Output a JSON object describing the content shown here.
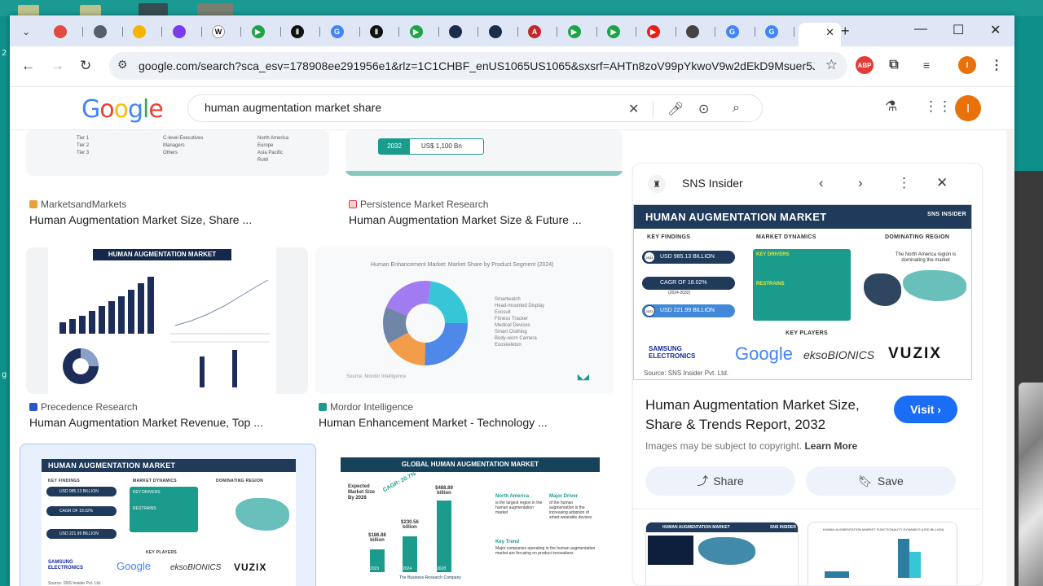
{
  "browser": {
    "url": "google.com/search?sca_esv=178908ee291956e1&rlz=1C1CHBF_enUS1065US1065&sxsrf=AHTn8zoV99pYkwoV9w2dEkD9Msuer5Jl...",
    "tabs": [
      {
        "color": "#e04a3f",
        "glyph": ""
      },
      {
        "color": "#555e6b",
        "glyph": ""
      },
      {
        "color": "#f5b400",
        "glyph": ""
      },
      {
        "color": "#7c3aed",
        "glyph": ""
      },
      {
        "color": "#ffffff",
        "glyph": "W"
      },
      {
        "color": "#1ea446",
        "glyph": "▶"
      },
      {
        "color": "#111111",
        "glyph": "Ⅱ"
      },
      {
        "color": "#4285f4",
        "glyph": "G"
      },
      {
        "color": "#111111",
        "glyph": "Ⅱ"
      },
      {
        "color": "#1ea446",
        "glyph": "▶"
      },
      {
        "color": "#1c2c4c",
        "glyph": ""
      },
      {
        "color": "#1c2c4c",
        "glyph": ""
      },
      {
        "color": "#c62828",
        "glyph": "A"
      },
      {
        "color": "#1ea446",
        "glyph": "▶"
      },
      {
        "color": "#1ea446",
        "glyph": "▶"
      },
      {
        "color": "#e62117",
        "glyph": "▶"
      },
      {
        "color": "#444444",
        "glyph": ""
      },
      {
        "color": "#4285f4",
        "glyph": "G"
      },
      {
        "color": "#4285f4",
        "glyph": "G"
      }
    ]
  },
  "google": {
    "query": "human augmentation market share"
  },
  "results": [
    {
      "source": "MarketsandMarkets",
      "title": "Human Augmentation Market Size, Share ..."
    },
    {
      "source": "Persistence Market Research",
      "title": "Human Augmentation Market Size & Future ..."
    },
    {
      "source": "Precedence Research",
      "title": "Human Augmentation Market Revenue, Top ..."
    },
    {
      "source": "Mordor Intelligence",
      "title": "Human Enhancement Market - Technology ..."
    }
  ],
  "thumbs": {
    "t1_legend": [
      "Tier 1",
      "Tier 2",
      "Tier 3",
      "C-level Executives",
      "Managers",
      "Others",
      "North America",
      "Europe",
      "Asia Pacific",
      "RoW"
    ],
    "t2_year": "2032",
    "t2_value": "US$ 1,100 Bn",
    "t3_title": "HUMAN AUGMENTATION MARKET",
    "t4_title": "Human Enhancement Market: Market Share by Product Segment (2024)",
    "t4_legend": [
      "Smartwatch",
      "Head-mounted Display",
      "Exosuit",
      "Fitness Tracker",
      "Medical Devices",
      "Smart Clothing",
      "Body-worn Camera",
      "Exoskeleton"
    ],
    "t4_source": "Source: Mordor Intelligence",
    "t6_title": "GLOBAL HUMAN AUGMENTATION MARKET",
    "t6_bars": [
      {
        "year": "2023",
        "value": "$186.88 billion"
      },
      {
        "year": "2024",
        "value": "$230.56 billion"
      },
      {
        "year": "2028",
        "value": "$488.89 billion"
      }
    ],
    "t6_cagr": "CAGR: 20.7%",
    "t6_expected": "Expected Market Size By 2028",
    "t6_na": "North America",
    "t6_na_text": "is the largest region in the human augmentation market",
    "t6_driver": "Major Driver",
    "t6_driver_text": "of the human augmentation is the increasing adoption of smart wearable devices",
    "t6_trend": "Key Trend",
    "t6_trend_text": "Major companies operating in the human augmentation market are focusing on product innovations",
    "t6_footer": "The Business Research Company"
  },
  "infographic": {
    "title": "HUMAN AUGMENTATION MARKET",
    "brand": "SNS INSIDER",
    "key_findings": "KEY FINDINGS",
    "market_dynamics": "MARKET DYNAMICS",
    "dominating_region": "DOMINATING REGION",
    "findings": [
      {
        "year": "2032",
        "text": "USD 985.13 BILLION"
      },
      {
        "year": "",
        "text": "CAGR OF 18.02%"
      },
      {
        "year": "2023",
        "text": "USD 221.99 BILLION"
      }
    ],
    "cagr_years": "(2024-2032)",
    "drivers_label": "KEY DRIVERS",
    "restraints_label": "RESTRAINS",
    "region_text": "The North America region is dominating the market",
    "key_players": "KEY PLAYERS",
    "players": [
      "SAMSUNG ELECTRONICS",
      "Google",
      "eksoBIONICS",
      "VUZIX"
    ],
    "source": "Source: SNS Insider Pvt. Ltd."
  },
  "panel": {
    "site": "SNS Insider",
    "title": "Human Augmentation Market Size, Share & Trends Report, 2032",
    "visit": "Visit",
    "copyright": "Images may be subject to copyright.",
    "learn_more": "Learn More",
    "share": "Share",
    "save": "Save",
    "related1_title": "HUMAN AUGMENTATION MARKET",
    "related1_brand": "SNS INSIDER",
    "related2_title": "HUMAN AUGMENTATION MARKET FUNCTIONALITY DYNAMICS (USD BILLION)"
  },
  "colors": {
    "accent": "#1a6ef5",
    "infographic_navy": "#1f3a5a",
    "infographic_teal": "#1a9b8c",
    "avatar": "#e8710a"
  }
}
